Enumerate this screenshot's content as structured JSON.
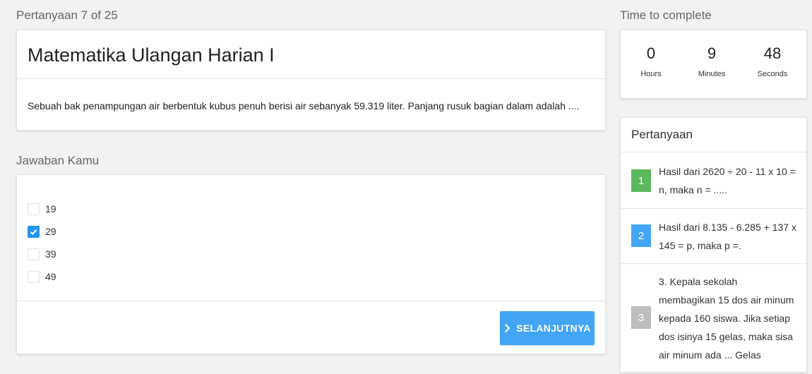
{
  "progress_label": "Pertanyaan 7 of 25",
  "question": {
    "title": "Matematika Ulangan Harian I",
    "text": "Sebuah bak penampungan air berbentuk kubus penuh berisi air sebanyak 59.319 liter. Panjang rusuk bagian dalam adalah ...."
  },
  "answers": {
    "heading": "Jawaban Kamu",
    "options": [
      {
        "label": "19",
        "checked": false
      },
      {
        "label": "29",
        "checked": true
      },
      {
        "label": "39",
        "checked": false
      },
      {
        "label": "49",
        "checked": false
      }
    ],
    "next_label": "SELANJUTNYA"
  },
  "timer": {
    "heading": "Time to complete",
    "hours": "0",
    "hours_label": "Hours",
    "minutes": "9",
    "minutes_label": "Minutes",
    "seconds": "48",
    "seconds_label": "Seconds"
  },
  "questions_panel": {
    "heading": "Pertanyaan",
    "items": [
      {
        "number": "1",
        "text": "Hasil dari 2620 ÷ 20 - 11 x 10 = n, maka n = .....",
        "status_color": "#5cb85c"
      },
      {
        "number": "2",
        "text": "Hasil dari 8.135 - 6.285 + 137 x 145 = p, maka p =.",
        "status_color": "#42a5f5"
      },
      {
        "number": "3",
        "text": "3. Kepala sekolah membagikan 15 dos air minum kepada 160 siswa. Jika setiap dos isinya 15 gelas, maka sisa air minum ada ... Gelas",
        "status_color": "#bdbdbd"
      }
    ]
  },
  "colors": {
    "accent": "#42a5f5",
    "answered": "#5cb85c",
    "unanswered": "#bdbdbd"
  }
}
